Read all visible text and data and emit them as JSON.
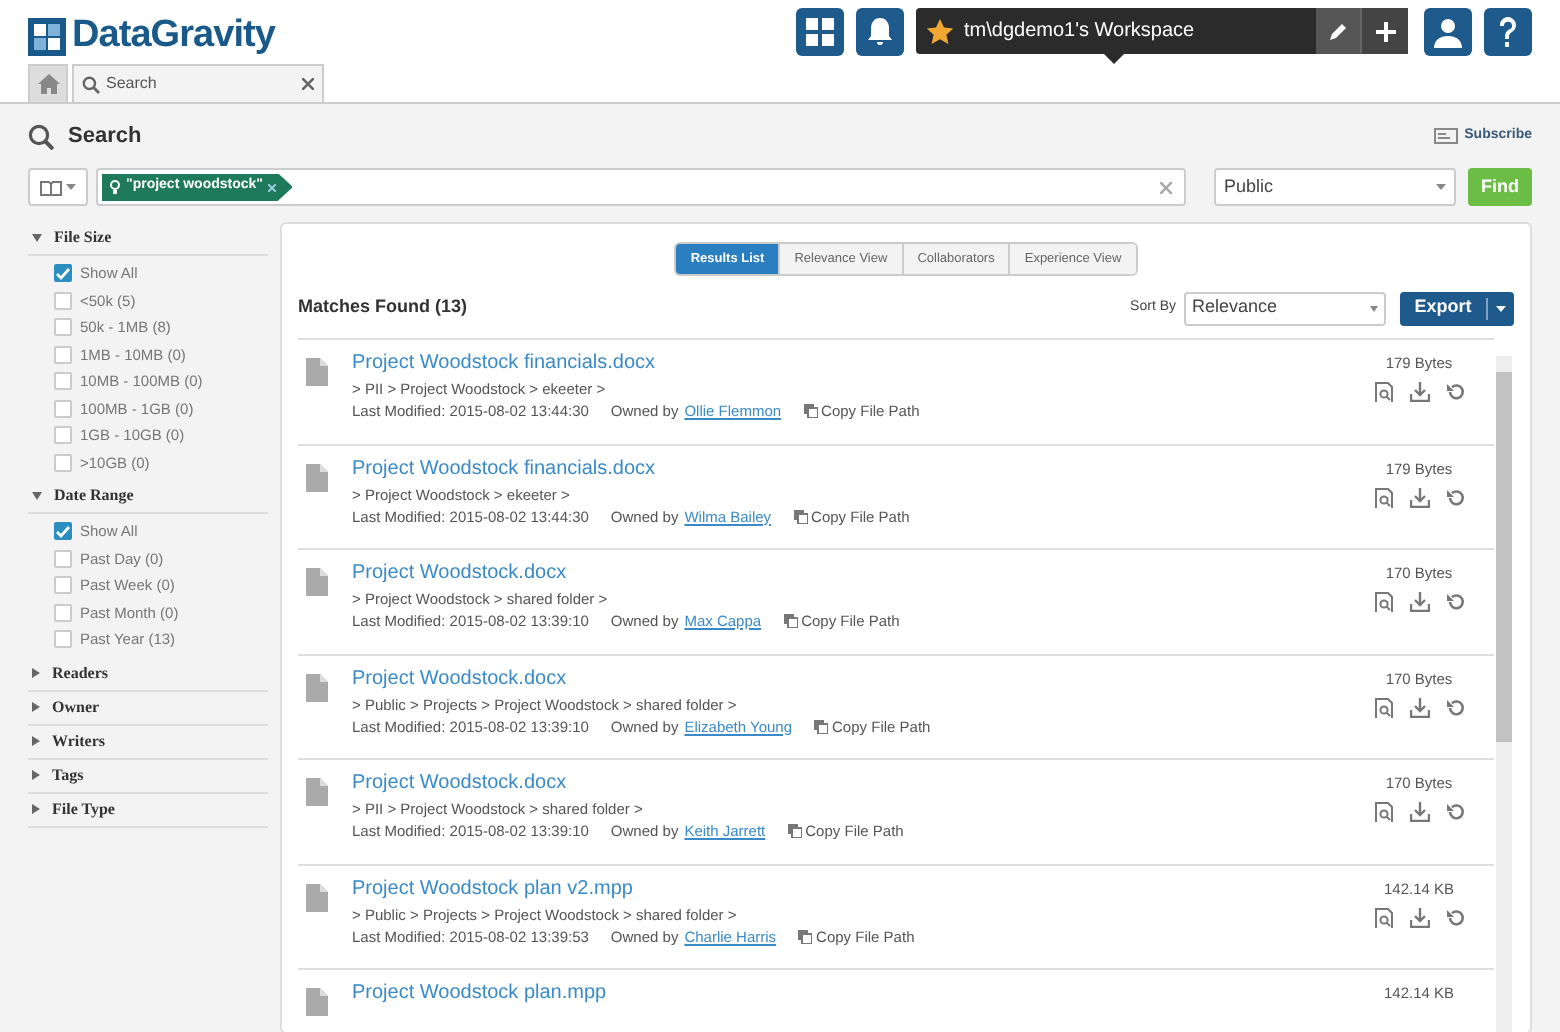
{
  "logo": {
    "text": "DataGravity"
  },
  "workspace": {
    "name": "tm\\dgdemo1's Workspace"
  },
  "tabs": [
    {
      "kind": "home",
      "selected": false
    },
    {
      "kind": "search",
      "label": "Search",
      "selected": true
    }
  ],
  "search": {
    "title": "Search",
    "subscribe": "Subscribe",
    "tag": "\"project woodstock\"",
    "scope": "Public",
    "find": "Find"
  },
  "filters": [
    {
      "title": "File Size",
      "expanded": true,
      "options": [
        {
          "label": "Show All",
          "checked": true
        },
        {
          "label": "<50k (5)",
          "checked": false
        },
        {
          "label": "50k - 1MB (8)",
          "checked": false
        },
        {
          "label": "1MB - 10MB (0)",
          "checked": false
        },
        {
          "label": "10MB - 100MB (0)",
          "checked": false
        },
        {
          "label": "100MB - 1GB (0)",
          "checked": false
        },
        {
          "label": "1GB - 10GB (0)",
          "checked": false
        },
        {
          "label": ">10GB (0)",
          "checked": false
        }
      ]
    },
    {
      "title": "Date Range",
      "expanded": true,
      "options": [
        {
          "label": "Show All",
          "checked": true
        },
        {
          "label": "Past Day (0)",
          "checked": false
        },
        {
          "label": "Past Week (0)",
          "checked": false
        },
        {
          "label": "Past Month (0)",
          "checked": false
        },
        {
          "label": "Past Year (13)",
          "checked": false
        }
      ]
    },
    {
      "title": "Readers",
      "expanded": false
    },
    {
      "title": "Owner",
      "expanded": false
    },
    {
      "title": "Writers",
      "expanded": false
    },
    {
      "title": "Tags",
      "expanded": false
    },
    {
      "title": "File Type",
      "expanded": false
    }
  ],
  "view_tabs": [
    {
      "label": "Results List",
      "selected": true
    },
    {
      "label": "Relevance View",
      "selected": false
    },
    {
      "label": "Collaborators",
      "selected": false
    },
    {
      "label": "Experience View",
      "selected": false
    }
  ],
  "matches": "Matches Found (13)",
  "sort": {
    "label": "Sort By",
    "value": "Relevance"
  },
  "export": "Export",
  "results": [
    {
      "name": "Project Woodstock financials.docx",
      "path": "> PII > Project Woodstock > ekeeter >",
      "modified": "Last Modified: 2015-08-02 13:44:30",
      "owned_by": "Owned by",
      "owner": "Ollie Flemmon",
      "copy": "Copy File Path",
      "size": "179 Bytes"
    },
    {
      "name": "Project Woodstock financials.docx",
      "path": "> Project Woodstock > ekeeter >",
      "modified": "Last Modified: 2015-08-02 13:44:30",
      "owned_by": "Owned by",
      "owner": "Wilma Bailey",
      "copy": "Copy File Path",
      "size": "179 Bytes"
    },
    {
      "name": "Project Woodstock.docx",
      "path": "> Project Woodstock > shared folder >",
      "modified": "Last Modified: 2015-08-02 13:39:10",
      "owned_by": "Owned by",
      "owner": "Max Cappa",
      "copy": "Copy File Path",
      "size": "170 Bytes"
    },
    {
      "name": "Project Woodstock.docx",
      "path": "> Public > Projects > Project Woodstock > shared folder >",
      "modified": "Last Modified: 2015-08-02 13:39:10",
      "owned_by": "Owned by",
      "owner": "Elizabeth Young",
      "copy": "Copy File Path",
      "size": "170 Bytes"
    },
    {
      "name": "Project Woodstock.docx",
      "path": "> PII > Project Woodstock > shared folder >",
      "modified": "Last Modified: 2015-08-02 13:39:10",
      "owned_by": "Owned by",
      "owner": "Keith Jarrett",
      "copy": "Copy File Path",
      "size": "170 Bytes"
    },
    {
      "name": "Project Woodstock plan v2.mpp",
      "path": "> Public > Projects > Project Woodstock > shared folder >",
      "modified": "Last Modified: 2015-08-02 13:39:53",
      "owned_by": "Owned by",
      "owner": "Charlie Harris",
      "copy": "Copy File Path",
      "size": "142.14 KB"
    },
    {
      "name": "Project Woodstock plan.mpp",
      "size": "142.14 KB"
    }
  ]
}
